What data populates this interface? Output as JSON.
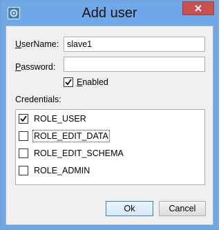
{
  "window": {
    "title": "Add user",
    "close_icon": "close-icon",
    "app_icon": "app-icon"
  },
  "form": {
    "username_label": "UserName:",
    "username_value": "slave1",
    "password_label": "Password:",
    "password_value": "",
    "enabled_label": "Enabled",
    "enabled_checked": true,
    "credentials_label": "Credentials:"
  },
  "credentials": [
    {
      "label": "ROLE_USER",
      "checked": true
    },
    {
      "label": "ROLE_EDIT_DATA",
      "checked": false
    },
    {
      "label": "ROLE_EDIT_SCHEMA",
      "checked": false
    },
    {
      "label": "ROLE_ADMIN",
      "checked": false
    }
  ],
  "buttons": {
    "ok": "Ok",
    "cancel": "Cancel"
  },
  "colors": {
    "titlebar": "#6fa8e8",
    "close": "#c75050",
    "dialog_bg": "#f0f0f0"
  }
}
